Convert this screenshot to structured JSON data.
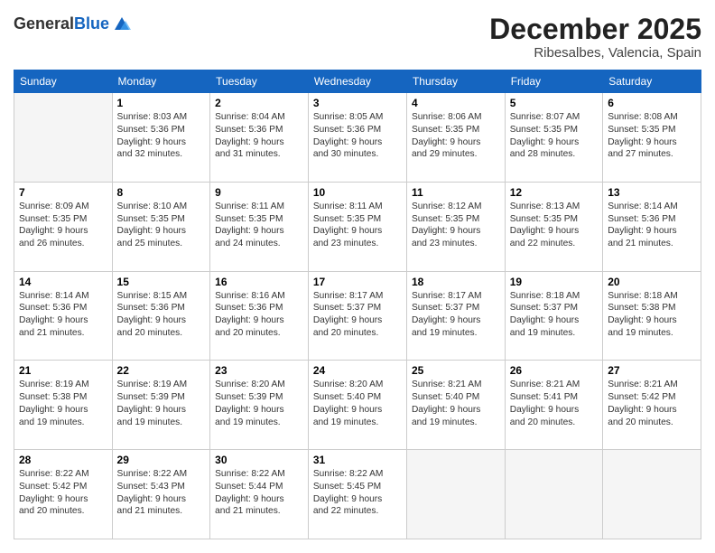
{
  "header": {
    "logo_general": "General",
    "logo_blue": "Blue",
    "month_title": "December 2025",
    "location": "Ribesalbes, Valencia, Spain"
  },
  "weekdays": [
    "Sunday",
    "Monday",
    "Tuesday",
    "Wednesday",
    "Thursday",
    "Friday",
    "Saturday"
  ],
  "weeks": [
    [
      {
        "day": "",
        "info": ""
      },
      {
        "day": "1",
        "info": "Sunrise: 8:03 AM\nSunset: 5:36 PM\nDaylight: 9 hours\nand 32 minutes."
      },
      {
        "day": "2",
        "info": "Sunrise: 8:04 AM\nSunset: 5:36 PM\nDaylight: 9 hours\nand 31 minutes."
      },
      {
        "day": "3",
        "info": "Sunrise: 8:05 AM\nSunset: 5:36 PM\nDaylight: 9 hours\nand 30 minutes."
      },
      {
        "day": "4",
        "info": "Sunrise: 8:06 AM\nSunset: 5:35 PM\nDaylight: 9 hours\nand 29 minutes."
      },
      {
        "day": "5",
        "info": "Sunrise: 8:07 AM\nSunset: 5:35 PM\nDaylight: 9 hours\nand 28 minutes."
      },
      {
        "day": "6",
        "info": "Sunrise: 8:08 AM\nSunset: 5:35 PM\nDaylight: 9 hours\nand 27 minutes."
      }
    ],
    [
      {
        "day": "7",
        "info": "Sunrise: 8:09 AM\nSunset: 5:35 PM\nDaylight: 9 hours\nand 26 minutes."
      },
      {
        "day": "8",
        "info": "Sunrise: 8:10 AM\nSunset: 5:35 PM\nDaylight: 9 hours\nand 25 minutes."
      },
      {
        "day": "9",
        "info": "Sunrise: 8:11 AM\nSunset: 5:35 PM\nDaylight: 9 hours\nand 24 minutes."
      },
      {
        "day": "10",
        "info": "Sunrise: 8:11 AM\nSunset: 5:35 PM\nDaylight: 9 hours\nand 23 minutes."
      },
      {
        "day": "11",
        "info": "Sunrise: 8:12 AM\nSunset: 5:35 PM\nDaylight: 9 hours\nand 23 minutes."
      },
      {
        "day": "12",
        "info": "Sunrise: 8:13 AM\nSunset: 5:35 PM\nDaylight: 9 hours\nand 22 minutes."
      },
      {
        "day": "13",
        "info": "Sunrise: 8:14 AM\nSunset: 5:36 PM\nDaylight: 9 hours\nand 21 minutes."
      }
    ],
    [
      {
        "day": "14",
        "info": "Sunrise: 8:14 AM\nSunset: 5:36 PM\nDaylight: 9 hours\nand 21 minutes."
      },
      {
        "day": "15",
        "info": "Sunrise: 8:15 AM\nSunset: 5:36 PM\nDaylight: 9 hours\nand 20 minutes."
      },
      {
        "day": "16",
        "info": "Sunrise: 8:16 AM\nSunset: 5:36 PM\nDaylight: 9 hours\nand 20 minutes."
      },
      {
        "day": "17",
        "info": "Sunrise: 8:17 AM\nSunset: 5:37 PM\nDaylight: 9 hours\nand 20 minutes."
      },
      {
        "day": "18",
        "info": "Sunrise: 8:17 AM\nSunset: 5:37 PM\nDaylight: 9 hours\nand 19 minutes."
      },
      {
        "day": "19",
        "info": "Sunrise: 8:18 AM\nSunset: 5:37 PM\nDaylight: 9 hours\nand 19 minutes."
      },
      {
        "day": "20",
        "info": "Sunrise: 8:18 AM\nSunset: 5:38 PM\nDaylight: 9 hours\nand 19 minutes."
      }
    ],
    [
      {
        "day": "21",
        "info": "Sunrise: 8:19 AM\nSunset: 5:38 PM\nDaylight: 9 hours\nand 19 minutes."
      },
      {
        "day": "22",
        "info": "Sunrise: 8:19 AM\nSunset: 5:39 PM\nDaylight: 9 hours\nand 19 minutes."
      },
      {
        "day": "23",
        "info": "Sunrise: 8:20 AM\nSunset: 5:39 PM\nDaylight: 9 hours\nand 19 minutes."
      },
      {
        "day": "24",
        "info": "Sunrise: 8:20 AM\nSunset: 5:40 PM\nDaylight: 9 hours\nand 19 minutes."
      },
      {
        "day": "25",
        "info": "Sunrise: 8:21 AM\nSunset: 5:40 PM\nDaylight: 9 hours\nand 19 minutes."
      },
      {
        "day": "26",
        "info": "Sunrise: 8:21 AM\nSunset: 5:41 PM\nDaylight: 9 hours\nand 20 minutes."
      },
      {
        "day": "27",
        "info": "Sunrise: 8:21 AM\nSunset: 5:42 PM\nDaylight: 9 hours\nand 20 minutes."
      }
    ],
    [
      {
        "day": "28",
        "info": "Sunrise: 8:22 AM\nSunset: 5:42 PM\nDaylight: 9 hours\nand 20 minutes."
      },
      {
        "day": "29",
        "info": "Sunrise: 8:22 AM\nSunset: 5:43 PM\nDaylight: 9 hours\nand 21 minutes."
      },
      {
        "day": "30",
        "info": "Sunrise: 8:22 AM\nSunset: 5:44 PM\nDaylight: 9 hours\nand 21 minutes."
      },
      {
        "day": "31",
        "info": "Sunrise: 8:22 AM\nSunset: 5:45 PM\nDaylight: 9 hours\nand 22 minutes."
      },
      {
        "day": "",
        "info": ""
      },
      {
        "day": "",
        "info": ""
      },
      {
        "day": "",
        "info": ""
      }
    ]
  ]
}
